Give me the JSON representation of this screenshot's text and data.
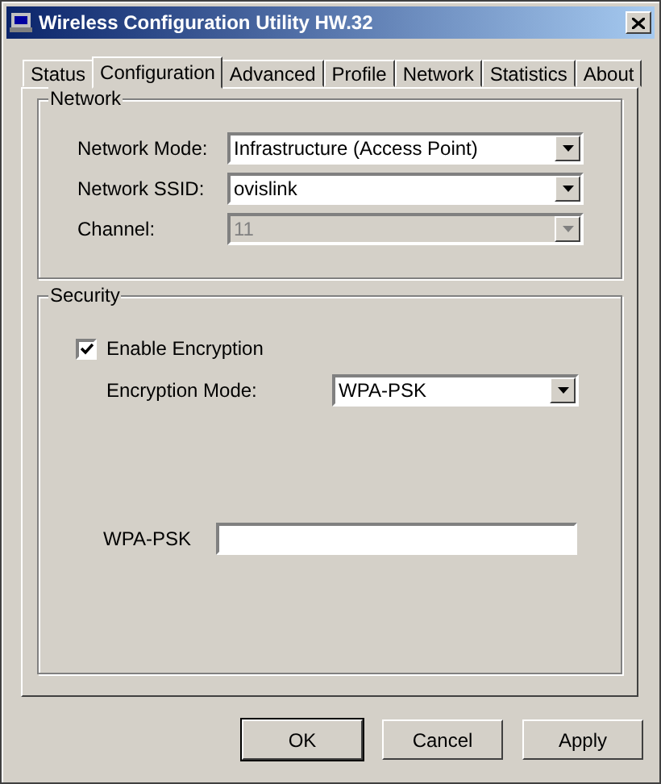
{
  "window": {
    "title": "Wireless Configuration Utility HW.32"
  },
  "tabs": [
    {
      "label": "Status",
      "selected": false
    },
    {
      "label": "Configuration",
      "selected": true
    },
    {
      "label": "Advanced",
      "selected": false
    },
    {
      "label": "Profile",
      "selected": false
    },
    {
      "label": "Network",
      "selected": false
    },
    {
      "label": "Statistics",
      "selected": false
    },
    {
      "label": "About",
      "selected": false
    }
  ],
  "network": {
    "title": "Network",
    "fields": [
      {
        "label": "Network Mode:",
        "value": "Infrastructure (Access Point)",
        "disabled": false
      },
      {
        "label": "Network SSID:",
        "value": "ovislink",
        "disabled": false
      },
      {
        "label": "Channel:",
        "value": "11",
        "disabled": true
      }
    ]
  },
  "security": {
    "title": "Security",
    "enable_encryption": {
      "label": "Enable Encryption",
      "checked": true
    },
    "encryption_mode": {
      "label": "Encryption Mode:",
      "value": "WPA-PSK"
    },
    "key": {
      "label": "WPA-PSK"
    }
  },
  "buttons": [
    {
      "label": "OK",
      "default": true
    },
    {
      "label": "Cancel",
      "default": false
    },
    {
      "label": "Apply",
      "default": false
    }
  ]
}
